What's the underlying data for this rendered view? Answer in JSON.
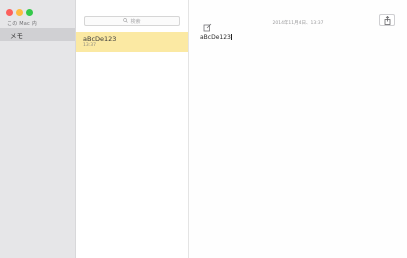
{
  "sidebar": {
    "account_label": "この Mac 内",
    "folder": {
      "label": "メモ",
      "selected": true
    }
  },
  "list": {
    "search": {
      "placeholder": "検索"
    },
    "notes": [
      {
        "title": "aBcDe123",
        "time": "13:37",
        "selected": true
      }
    ]
  },
  "editor": {
    "date": "2014年11月4日、13:37",
    "body": "aBcDe123",
    "compose_icon": "compose-icon",
    "share_icon": "share-icon"
  },
  "colors": {
    "selection_yellow": "#fbe9a3",
    "sidebar_bg": "#e6e6e8",
    "close": "#fc605c",
    "minimize": "#fdbc40",
    "zoom": "#34c84a"
  }
}
